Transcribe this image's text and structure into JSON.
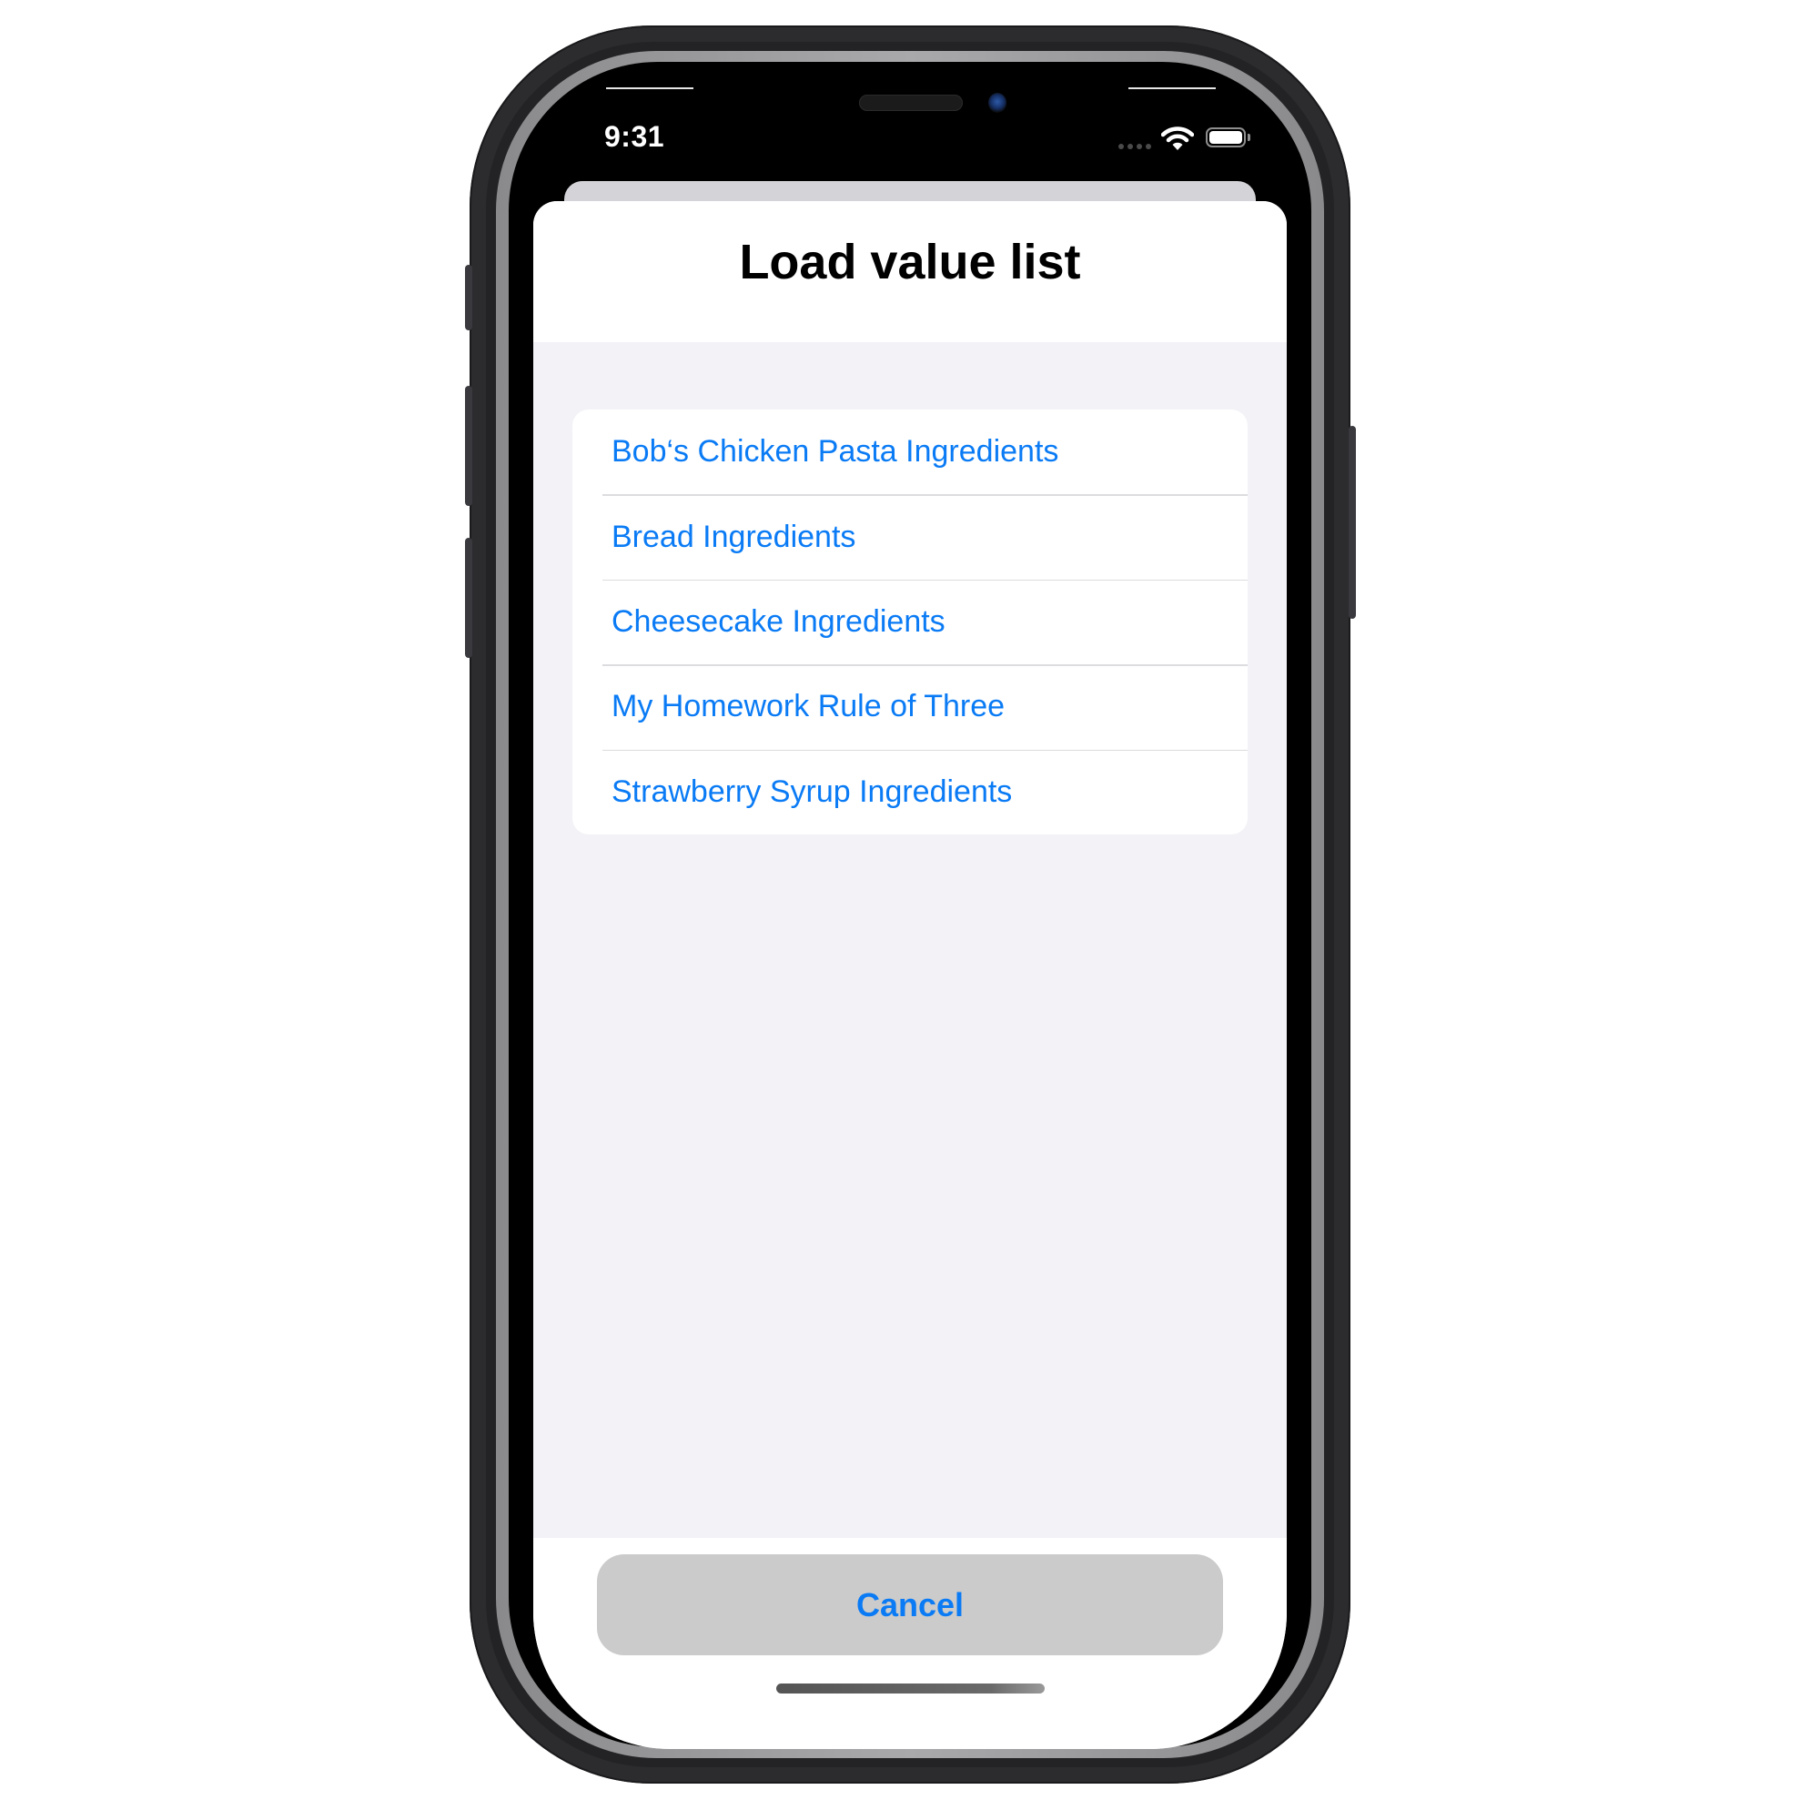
{
  "status_bar": {
    "time": "9:31",
    "icons": [
      "cellular-signal-icon",
      "wifi-icon",
      "battery-icon"
    ]
  },
  "sheet": {
    "title": "Load value list",
    "items": [
      {
        "label": "Bob‘s Chicken Pasta Ingredients"
      },
      {
        "label": "Bread Ingredients"
      },
      {
        "label": "Cheesecake Ingredients"
      },
      {
        "label": "My Homework Rule of Three"
      },
      {
        "label": "Strawberry Syrup Ingredients"
      }
    ],
    "cancel_label": "Cancel"
  },
  "colors": {
    "accent": "#0a7bf5",
    "sheet_background": "#f2f2f7",
    "cancel_button_background": "#cbcbcb"
  }
}
